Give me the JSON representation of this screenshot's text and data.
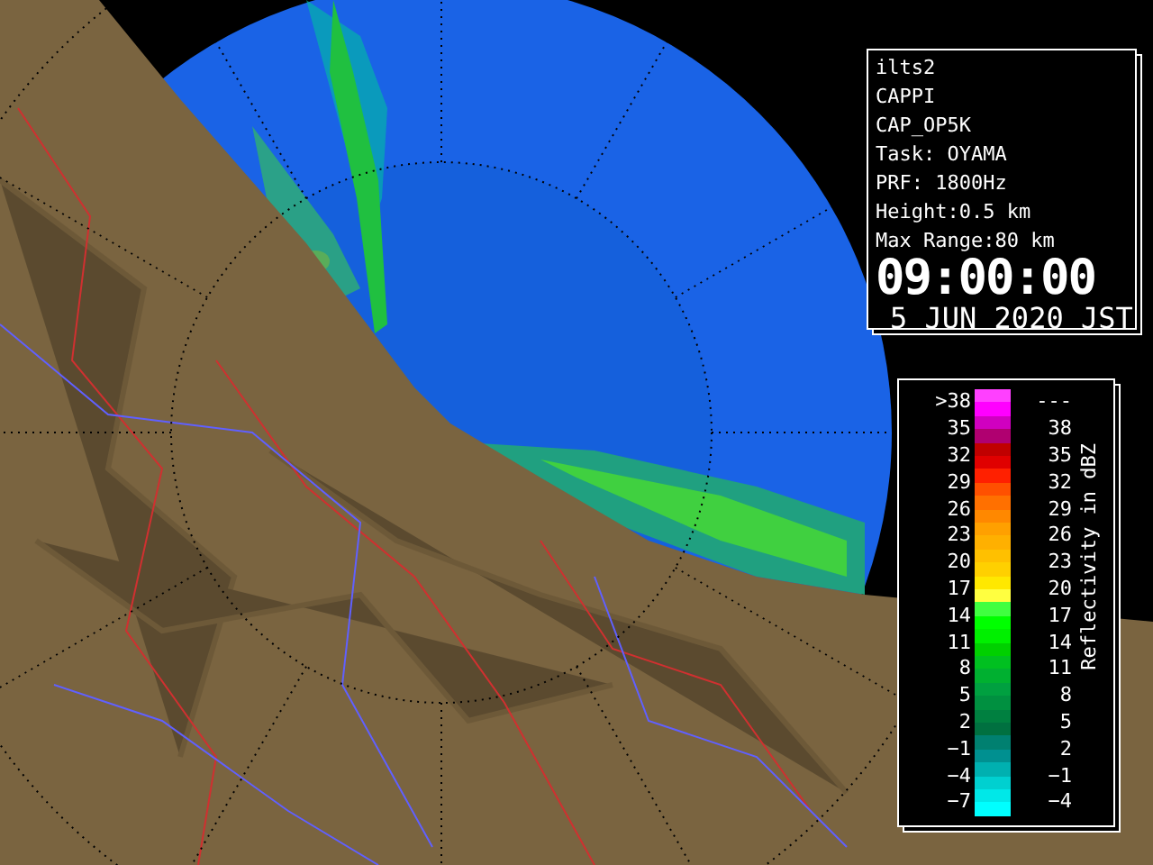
{
  "info_panel": {
    "lines": [
      "ilts2",
      "CAPPI",
      "CAP_OP5K",
      "Task: OYAMA",
      "PRF: 1800Hz",
      "Height:0.5 km",
      "Max Range:80 km"
    ],
    "time": "09:00:00",
    "date": "5 JUN 2020 JST"
  },
  "legend": {
    "title": "Reflectivity in dBZ",
    "rows": [
      {
        "low": ">38",
        "high": "---",
        "bands": [
          {
            "color": "#ff40ff"
          },
          {
            "color": "#ff00ff"
          }
        ]
      },
      {
        "low": "35",
        "high": "38",
        "bands": [
          {
            "color": "#d000c0"
          },
          {
            "color": "#b00070"
          }
        ]
      },
      {
        "low": "32",
        "high": "35",
        "bands": [
          {
            "color": "#c00000"
          },
          {
            "color": "#e00000"
          }
        ]
      },
      {
        "low": "29",
        "high": "32",
        "bands": [
          {
            "color": "#ff2000"
          },
          {
            "color": "#ff5000"
          }
        ]
      },
      {
        "low": "26",
        "high": "29",
        "bands": [
          {
            "color": "#ff7000"
          },
          {
            "color": "#ff8800"
          }
        ]
      },
      {
        "low": "23",
        "high": "26",
        "bands": [
          {
            "color": "#ffa000"
          },
          {
            "color": "#ffb000"
          }
        ]
      },
      {
        "low": "20",
        "high": "23",
        "bands": [
          {
            "color": "#ffc000"
          },
          {
            "color": "#ffd000"
          }
        ]
      },
      {
        "low": "17",
        "high": "20",
        "bands": [
          {
            "color": "#ffe800"
          },
          {
            "color": "#ffff40"
          }
        ]
      },
      {
        "low": "14",
        "high": "17",
        "bands": [
          {
            "color": "#40ff40"
          },
          {
            "color": "#00ff00"
          }
        ]
      },
      {
        "low": "11",
        "high": "14",
        "bands": [
          {
            "color": "#00f000"
          },
          {
            "color": "#00d000"
          }
        ]
      },
      {
        "low": "8",
        "high": "11",
        "bands": [
          {
            "color": "#00c020"
          },
          {
            "color": "#00b030"
          }
        ]
      },
      {
        "low": "5",
        "high": "8",
        "bands": [
          {
            "color": "#00a040"
          },
          {
            "color": "#009040"
          }
        ]
      },
      {
        "low": "2",
        "high": "5",
        "bands": [
          {
            "color": "#008040"
          },
          {
            "color": "#007040"
          }
        ]
      },
      {
        "low": "−1",
        "high": "2",
        "bands": [
          {
            "color": "#008070"
          },
          {
            "color": "#009090"
          }
        ]
      },
      {
        "low": "−4",
        "high": "−1",
        "bands": [
          {
            "color": "#00b0b0"
          },
          {
            "color": "#00d0d0"
          }
        ]
      },
      {
        "low": "−7",
        "high": "−4",
        "bands": [
          {
            "color": "#00e8e8"
          },
          {
            "color": "#00ffff"
          }
        ]
      }
    ]
  }
}
